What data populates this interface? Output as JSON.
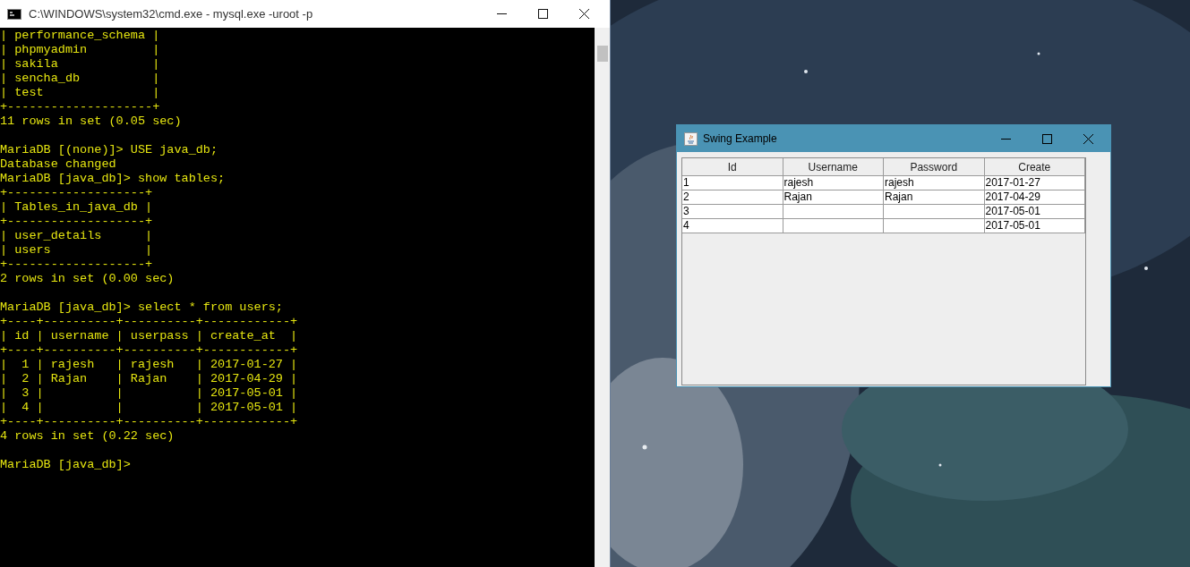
{
  "console_window": {
    "title": "C:\\WINDOWS\\system32\\cmd.exe - mysql.exe  -uroot -p",
    "blocks": [
      [
        "| performance_schema |",
        "| phpmyadmin         |",
        "| sakila             |",
        "| sencha_db          |",
        "| test               |",
        "+--------------------+",
        "11 rows in set (0.05 sec)"
      ],
      [
        "MariaDB [(none)]> USE java_db;",
        "Database changed",
        "MariaDB [java_db]> show tables;",
        "+-------------------+",
        "| Tables_in_java_db |",
        "+-------------------+",
        "| user_details      |",
        "| users             |",
        "+-------------------+",
        "2 rows in set (0.00 sec)"
      ],
      [
        "MariaDB [java_db]> select * from users;",
        "+----+----------+----------+------------+",
        "| id | username | userpass | create_at  |",
        "+----+----------+----------+------------+",
        "|  1 | rajesh   | rajesh   | 2017-01-27 |",
        "|  2 | Rajan    | Rajan    | 2017-04-29 |",
        "|  3 |          |          | 2017-05-01 |",
        "|  4 |          |          | 2017-05-01 |",
        "+----+----------+----------+------------+",
        "4 rows in set (0.22 sec)"
      ],
      [
        "MariaDB [java_db]>"
      ]
    ]
  },
  "swing_window": {
    "title": "Swing Example",
    "table": {
      "columns": [
        "Id",
        "Username",
        "Password",
        "Create"
      ],
      "rows": [
        [
          "1",
          "rajesh",
          "rajesh",
          "2017-01-27"
        ],
        [
          "2",
          "Rajan",
          "Rajan",
          "2017-04-29"
        ],
        [
          "3",
          "",
          "",
          "2017-05-01"
        ],
        [
          "4",
          "",
          "",
          "2017-05-01"
        ]
      ]
    }
  }
}
